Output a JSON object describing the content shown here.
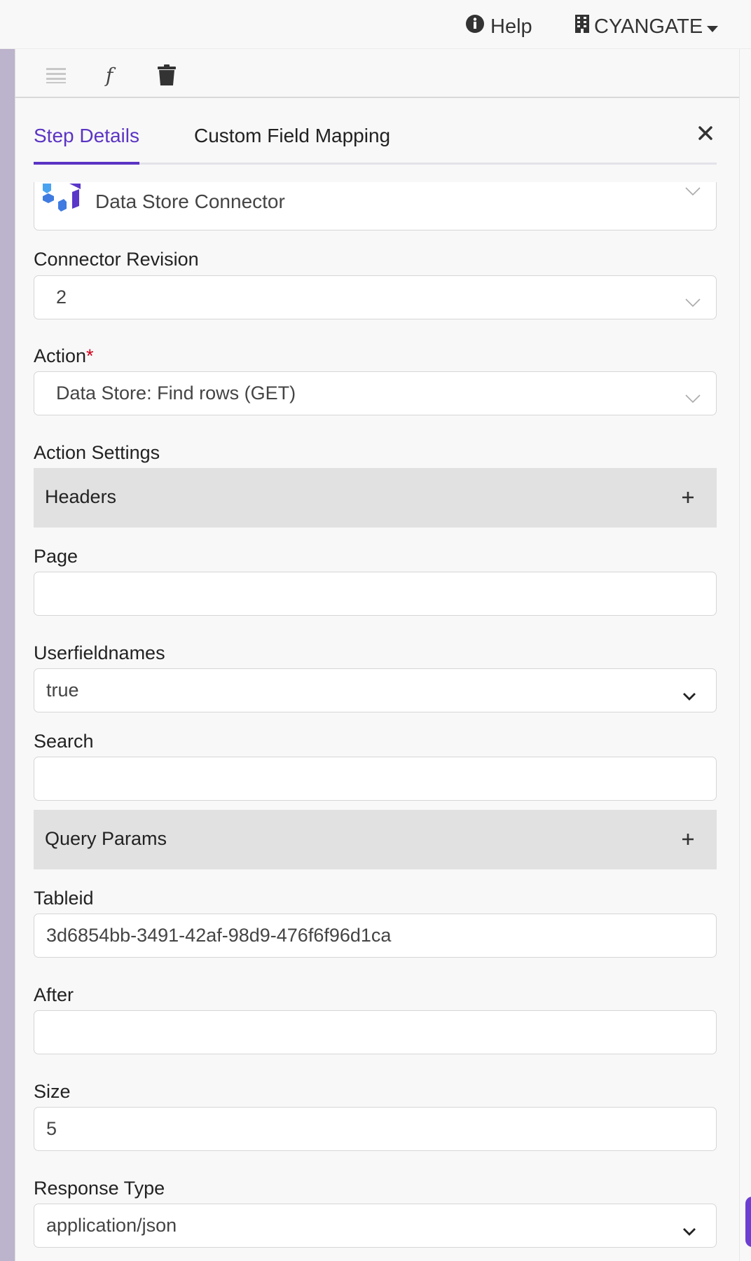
{
  "topbar": {
    "help_label": "Help",
    "org_label": "CYANGATE",
    "help_icon": "info-circle-icon",
    "org_icon": "building-icon"
  },
  "toolbar": {
    "icons": [
      "hamburger-menu-icon",
      "function-icon",
      "trash-icon"
    ],
    "function_glyph": "f"
  },
  "tabs": [
    {
      "label": "Step Details",
      "active": true
    },
    {
      "label": "Custom Field Mapping",
      "active": false
    }
  ],
  "connector": {
    "name": "Data Store Connector",
    "icon": "data-store-logo-icon"
  },
  "form": {
    "connector_revision": {
      "label": "Connector Revision",
      "value": "2"
    },
    "action": {
      "label": "Action",
      "required_mark": "*",
      "value": "Data Store: Find rows (GET)"
    },
    "action_settings_label": "Action Settings",
    "headers": {
      "label": "Headers",
      "icon": "plus-icon"
    },
    "page": {
      "label": "Page",
      "value": ""
    },
    "userfieldnames": {
      "label": "Userfieldnames",
      "value": "true"
    },
    "search": {
      "label": "Search",
      "value": ""
    },
    "query_params": {
      "label": "Query Params",
      "icon": "plus-icon"
    },
    "tableid": {
      "label": "Tableid",
      "value": "3d6854bb-3491-42af-98d9-476f6f96d1ca"
    },
    "after": {
      "label": "After",
      "value": ""
    },
    "size": {
      "label": "Size",
      "value": "5"
    },
    "response_type": {
      "label": "Response Type",
      "value": "application/json"
    }
  },
  "colors": {
    "accent": "#5b34c4",
    "required": "#d0021b",
    "section_bg": "#e1e1e1",
    "sidebar_stripe": "#bcb3cc"
  }
}
